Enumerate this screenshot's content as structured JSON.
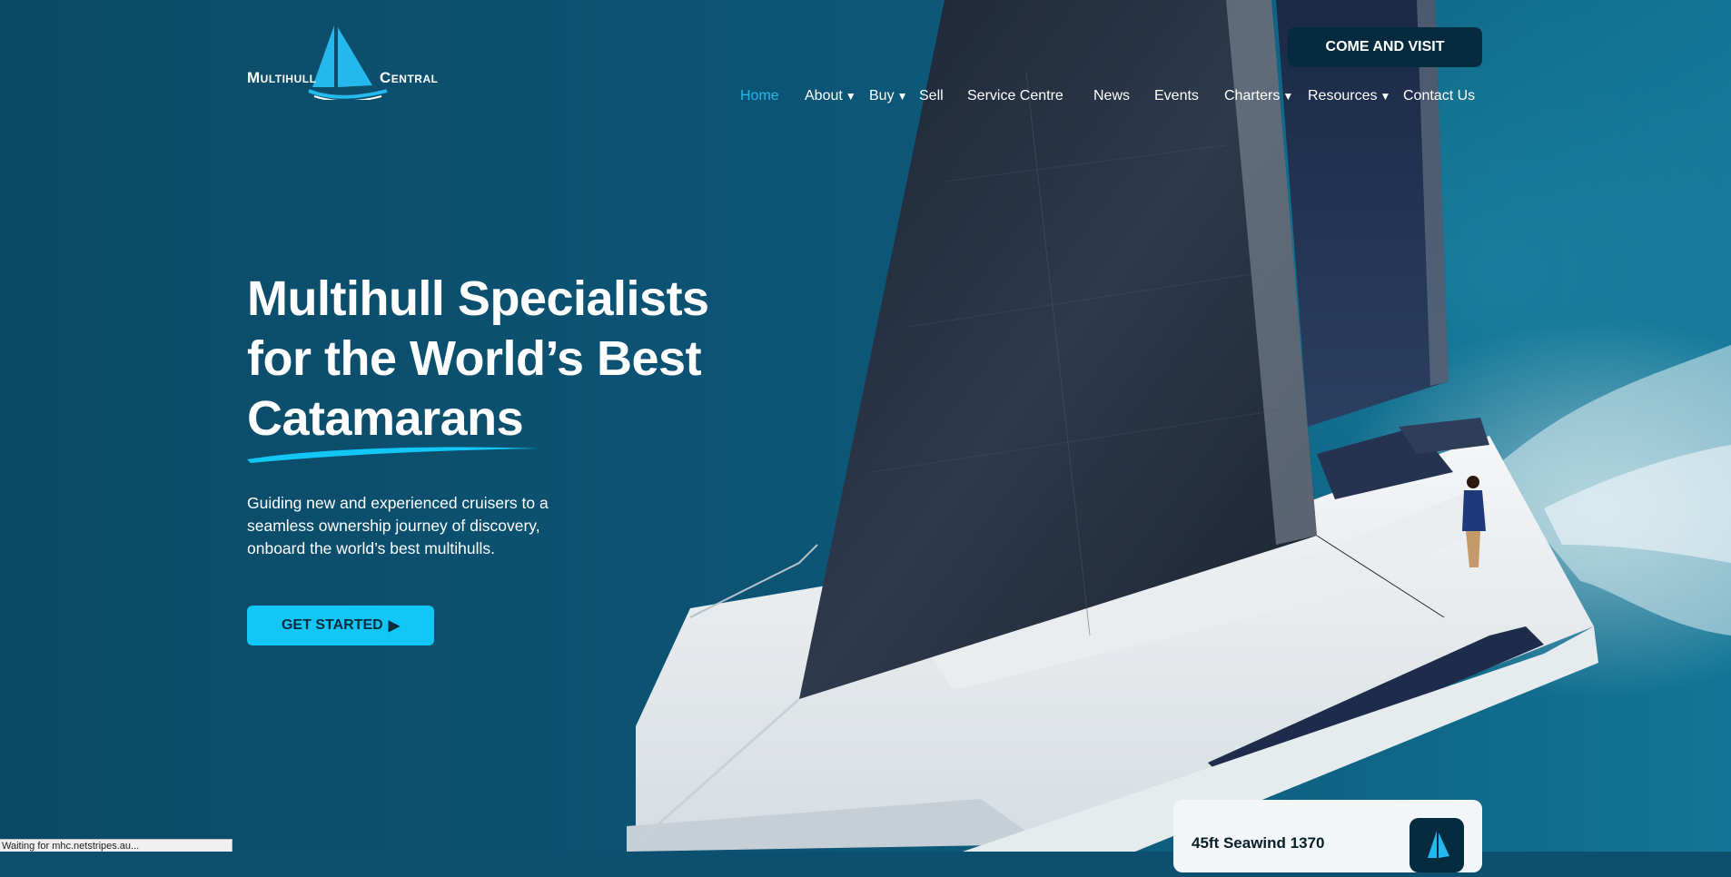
{
  "logo": {
    "word_left": "Multihull",
    "word_right": "Central",
    "accent_color": "#25b8ec"
  },
  "header": {
    "cta_label": "COME AND VISIT",
    "nav": [
      {
        "label": "Home",
        "active": true,
        "dropdown": false
      },
      {
        "label": "About",
        "active": false,
        "dropdown": true
      },
      {
        "label": "Buy",
        "active": false,
        "dropdown": true
      },
      {
        "label": "Sell",
        "active": false,
        "dropdown": false
      },
      {
        "label": "Service Centre",
        "active": false,
        "dropdown": false
      },
      {
        "label": "News",
        "active": false,
        "dropdown": false
      },
      {
        "label": "Events",
        "active": false,
        "dropdown": false
      },
      {
        "label": "Charters",
        "active": false,
        "dropdown": true
      },
      {
        "label": "Resources",
        "active": false,
        "dropdown": true
      },
      {
        "label": "Contact Us",
        "active": false,
        "dropdown": false
      }
    ],
    "dropdown_icon": "caret-down-icon"
  },
  "hero": {
    "headline_lines": [
      "Multihull Specialists",
      "for the World’s Best",
      "Catamarans"
    ],
    "subtext_lines": [
      "Guiding new and experienced cruisers to a",
      "seamless ownership journey of discovery,",
      "onboard the world’s best multihulls."
    ],
    "cta_label": "GET STARTED",
    "cta_icon": "play-triangle-icon",
    "cta_glyph": "▶",
    "accent_color": "#12c6f5",
    "image": "catamaran-sailing-photo"
  },
  "featured_card": {
    "title": "45ft Seawind 1370",
    "badge_icon": "sail-logo-icon"
  },
  "browser_status": {
    "text": "Waiting for mhc.netstripes.au..."
  }
}
